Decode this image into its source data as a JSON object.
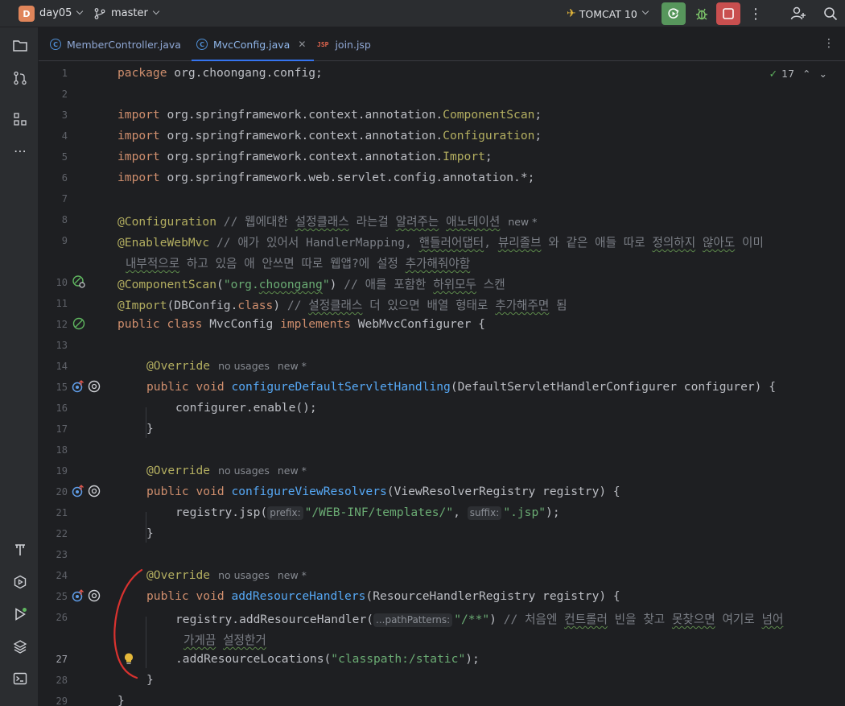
{
  "titlebar": {
    "project_badge": "D",
    "project_name": "day05",
    "branch": "master",
    "run_config": "TOMCAT 10",
    "icons": [
      "run-icon",
      "debug-icon",
      "stop-icon",
      "more-icon",
      "add-user-icon",
      "search-icon"
    ],
    "colors": {
      "run": "#57965c",
      "stop": "#c94f4f",
      "badge": "#e0855a"
    }
  },
  "leftbar": {
    "icons": [
      "project-icon",
      "commit-icon",
      "structure-icon",
      "more-tools-icon",
      "build-icon",
      "services-icon",
      "run-icon",
      "layers-icon",
      "terminal-icon"
    ]
  },
  "tabs": [
    {
      "label": "MemberController.java",
      "type": "java"
    },
    {
      "label": "MvcConfig.java",
      "type": "java",
      "active": true
    },
    {
      "label": "join.jsp",
      "type": "jsp"
    }
  ],
  "tab_icons": {
    "java": "C",
    "jsp": "JSP"
  },
  "inspection": {
    "count": "17"
  },
  "lines": [
    "1",
    "2",
    "3",
    "4",
    "5",
    "6",
    "7",
    "8",
    "9",
    "",
    "10",
    "11",
    "12",
    "13",
    "14",
    "15",
    "16",
    "17",
    "18",
    "19",
    "20",
    "21",
    "22",
    "23",
    "24",
    "25",
    "26",
    "",
    "27",
    "28",
    "29"
  ],
  "code": {
    "l1_kw": "package",
    "l1_rest": " org.choongang.config;",
    "import_kw": "import",
    "l3_rest": " org.springframework.context.annotation.",
    "l3_cls": "ComponentScan",
    "l4_cls": "Configuration",
    "l5_cls": "Import",
    "l6_rest": " org.springframework.web.servlet.config.annotation.*;",
    "semi": ";",
    "l8_ann": "@Configuration",
    "l8_cmt_pre": " // 웹에대한 ",
    "l8_cmt_w1": "설정클래스",
    "l8_cmt_mid": " 라는걸 ",
    "l8_cmt_w2": "알려주는",
    "l8_cmt_sp": " ",
    "l8_cmt_w3": "애노테이션",
    "l8_hint": "new *",
    "l9_ann": "@EnableWebMvc",
    "l9_cmt_a": " // 애가 있어서 HandlerMapping, ",
    "l9_cmt_w1": "핸들러어댑터",
    "l9_cmt_b": ", ",
    "l9_cmt_w2": "뷰리졸브",
    "l9_cmt_c": " 와 같은 애들 따로 ",
    "l9_cmt_w3": "정의하지",
    "l9_cmt_d": " ",
    "l9_cmt_w4": "않아도",
    "l9_cmt_e": " 이미",
    "l9b_w1": "내부적으로",
    "l9b_a": " 하고 있음 애 안쓰면 따로 웹앱?에 설정 ",
    "l9b_w2": "추가해줘야함",
    "l10_ann": "@ComponentScan",
    "l10_open": "(",
    "l10_str_a": "\"org.",
    "l10_str_w": "choongang",
    "l10_str_b": "\"",
    "l10_close": ")",
    "l10_cmt_a": " // 애를 포함한 ",
    "l10_cmt_w": "하위모두",
    "l10_cmt_b": " 스캔",
    "l11_ann": "@Import",
    "l11_a": "(DBConfig.",
    "l11_kw": "class",
    "l11_b": ")",
    "l11_cmt_a": " // ",
    "l11_cmt_w1": "설정클래스",
    "l11_cmt_b": " 더 있으면 배열 형태로 ",
    "l11_cmt_w2": "추가해주면",
    "l11_cmt_c": " 됨",
    "l12_kw1": "public",
    "l12_sp": " ",
    "l12_kw2": "class",
    "l12_name": " MvcConfig ",
    "l12_kw3": "implements",
    "l12_rest": " WebMvcConfigurer {",
    "override": "@Override",
    "no_usages": "no usages",
    "new_star": "new *",
    "pv_kw1": "public",
    "pv_kw2": "void",
    "l15_fn": "configureDefaultServletHandling",
    "l15_rest": "(DefaultServletHandlerConfigurer configurer) {",
    "l16": "configurer.enable();",
    "close_brace": "}",
    "l20_fn": "configureViewResolvers",
    "l20_rest": "(ViewResolverRegistry registry) {",
    "l21_a": "registry.jsp(",
    "l21_hint1": "prefix:",
    "l21_str1": "\"/WEB-INF/templates/\"",
    "l21_comma": ", ",
    "l21_hint2": "suffix:",
    "l21_str2": "\".jsp\"",
    "l21_end": ");",
    "l25_fn": "addResourceHandlers",
    "l25_rest": "(ResourceHandlerRegistry registry) {",
    "l26_a": "registry.addResourceHandler(",
    "l26_hint": "...pathPatterns:",
    "l26_str": "\"/**\"",
    "l26_b": ")",
    "l26_cmt_a": " // 처음엔 ",
    "l26_cmt_w1": "컨트롤러",
    "l26_cmt_b": " 빈을 찾고 ",
    "l26_cmt_w2": "못찾으면",
    "l26_cmt_c": " 여기로 ",
    "l26_cmt_w3": "넘어",
    "l26b_w1": "가게끔",
    "l26b_sp": " ",
    "l26b_w2": "설정한거",
    "l27_a": ".addResourceLocations(",
    "l27_str": "\"classpath:/static\"",
    "l27_b": ");",
    "l29": "}"
  }
}
